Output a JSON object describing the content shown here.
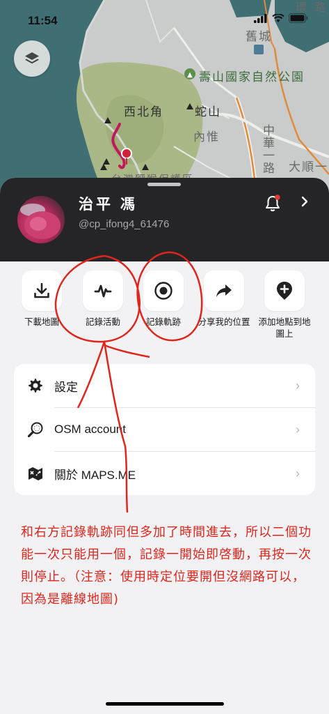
{
  "status_bar": {
    "time": "11:54"
  },
  "map": {
    "labels": {
      "shoushan_park": "壽山國家自然公園",
      "xibeijiao": "西北角",
      "sheshan": "蛇山",
      "neiwei": "內惟",
      "jiucheng": "舊城",
      "zhonghua_road": "中華一路",
      "dashun": "大順一",
      "partial_bottom": "台灣獼猴保護區",
      "partial_top_right": "環",
      "partial_top_right2": "路"
    }
  },
  "profile": {
    "name": "治平 馮",
    "handle": "@cp_ifong4_61476"
  },
  "actions": [
    {
      "label": "下載地圖",
      "icon": "download-icon"
    },
    {
      "label": "記錄活動",
      "icon": "activity-icon"
    },
    {
      "label": "記錄軌跡",
      "icon": "record-icon"
    },
    {
      "label": "分享我的位置",
      "icon": "share-icon"
    },
    {
      "label": "添加地點到地圖上",
      "icon": "add-place-icon"
    }
  ],
  "menu": [
    {
      "label": "設定",
      "icon": "gear-icon"
    },
    {
      "label": "OSM account",
      "icon": "magnifier-icon"
    },
    {
      "label": "關於 MAPS.ME",
      "icon": "map-icon"
    }
  ],
  "note": "和右方記錄軌跡同但多加了時間進去，所以二個功能一次只能用一個，記錄一開始即啓動，再按一次則停止。（注意：使用時定位要開但沒網路可以，因為是離線地圖)",
  "colors": {
    "profile_bg": "#252527",
    "sheet_bg": "#f2f2f4",
    "annotation_red": "#e0261c",
    "route_pink": "#c2185b"
  }
}
